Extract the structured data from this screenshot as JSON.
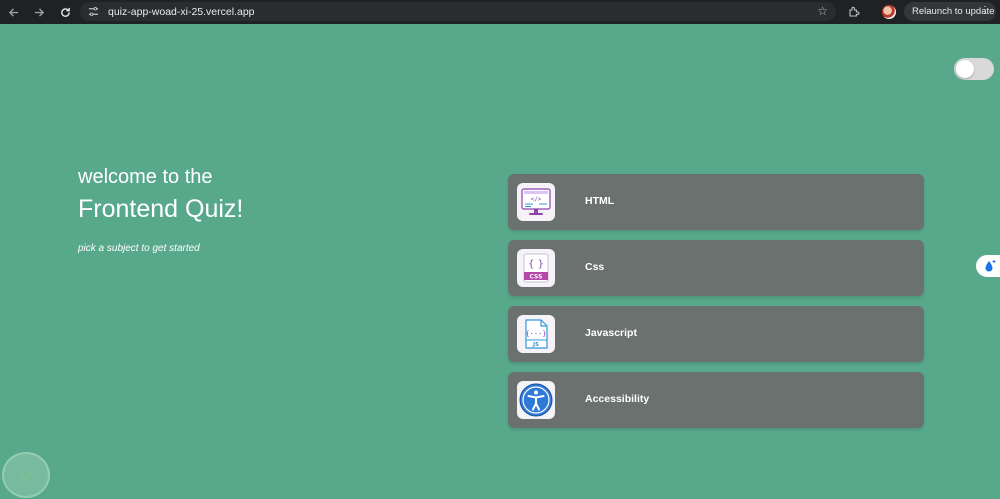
{
  "browser": {
    "url": "quiz-app-woad-xi-25.vercel.app",
    "relaunch_label": "Relaunch to update",
    "back_icon": "arrow-left-icon",
    "forward_icon": "arrow-right-icon",
    "reload_icon": "reload-icon"
  },
  "page": {
    "welcome": "welcome to the",
    "title": "Frontend Quiz!",
    "subtitle": "pick a subject to get started",
    "theme_toggle_on": false
  },
  "subjects": [
    {
      "label": "HTML",
      "icon": "html-icon"
    },
    {
      "label": "Css",
      "icon": "css-icon"
    },
    {
      "label": "Javascript",
      "icon": "javascript-icon"
    },
    {
      "label": "Accessibility",
      "icon": "accessibility-icon"
    }
  ],
  "colors": {
    "background": "#58a98c",
    "card": "#6a716f",
    "text": "#ffffff"
  }
}
